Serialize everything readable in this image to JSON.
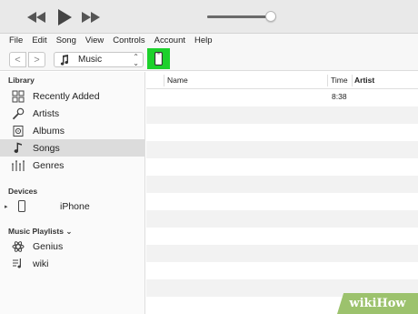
{
  "menu": [
    "File",
    "Edit",
    "Song",
    "View",
    "Controls",
    "Account",
    "Help"
  ],
  "player": {
    "volume_level": 0.92
  },
  "toolbar": {
    "back_label": "<",
    "forward_label": ">",
    "media_kind": "Music"
  },
  "sidebar": {
    "library_header": "Library",
    "library_items": [
      {
        "label": "Recently Added",
        "icon": "grid-icon"
      },
      {
        "label": "Artists",
        "icon": "microphone-icon"
      },
      {
        "label": "Albums",
        "icon": "album-icon"
      },
      {
        "label": "Songs",
        "icon": "music-note-icon",
        "selected": true
      },
      {
        "label": "Genres",
        "icon": "genres-icon"
      }
    ],
    "devices_header": "Devices",
    "device_label": "iPhone",
    "playlists_header": "Music Playlists",
    "playlist_items": [
      {
        "label": "Genius",
        "icon": "genius-atom-icon"
      },
      {
        "label": "wiki",
        "icon": "playlist-icon"
      }
    ]
  },
  "table": {
    "columns": [
      "Name",
      "Time",
      "Artist"
    ],
    "rows": [
      {
        "name": "",
        "time": "8:38",
        "artist": ""
      }
    ]
  },
  "watermark": {
    "brand": "wikiHow"
  },
  "colors": {
    "device_button_highlight": "#1dd12c",
    "selected_row": "#dcdcdc",
    "watermark_bg": "#9cc26d"
  }
}
